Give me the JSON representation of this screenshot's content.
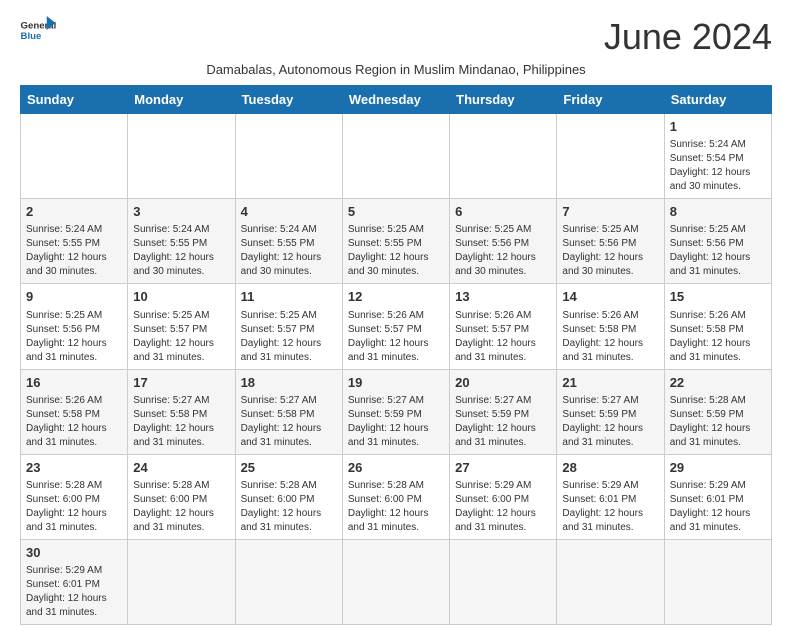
{
  "header": {
    "logo_general": "General",
    "logo_blue": "Blue",
    "month_title": "June 2024",
    "subtitle": "Damabalas, Autonomous Region in Muslim Mindanao, Philippines"
  },
  "weekdays": [
    "Sunday",
    "Monday",
    "Tuesday",
    "Wednesday",
    "Thursday",
    "Friday",
    "Saturday"
  ],
  "weeks": [
    {
      "days": [
        {
          "num": "",
          "info": ""
        },
        {
          "num": "",
          "info": ""
        },
        {
          "num": "",
          "info": ""
        },
        {
          "num": "",
          "info": ""
        },
        {
          "num": "",
          "info": ""
        },
        {
          "num": "",
          "info": ""
        },
        {
          "num": "1",
          "info": "Sunrise: 5:24 AM\nSunset: 5:54 PM\nDaylight: 12 hours and 30 minutes."
        }
      ]
    },
    {
      "days": [
        {
          "num": "2",
          "info": "Sunrise: 5:24 AM\nSunset: 5:55 PM\nDaylight: 12 hours and 30 minutes."
        },
        {
          "num": "3",
          "info": "Sunrise: 5:24 AM\nSunset: 5:55 PM\nDaylight: 12 hours and 30 minutes."
        },
        {
          "num": "4",
          "info": "Sunrise: 5:24 AM\nSunset: 5:55 PM\nDaylight: 12 hours and 30 minutes."
        },
        {
          "num": "5",
          "info": "Sunrise: 5:25 AM\nSunset: 5:55 PM\nDaylight: 12 hours and 30 minutes."
        },
        {
          "num": "6",
          "info": "Sunrise: 5:25 AM\nSunset: 5:56 PM\nDaylight: 12 hours and 30 minutes."
        },
        {
          "num": "7",
          "info": "Sunrise: 5:25 AM\nSunset: 5:56 PM\nDaylight: 12 hours and 30 minutes."
        },
        {
          "num": "8",
          "info": "Sunrise: 5:25 AM\nSunset: 5:56 PM\nDaylight: 12 hours and 31 minutes."
        }
      ]
    },
    {
      "days": [
        {
          "num": "9",
          "info": "Sunrise: 5:25 AM\nSunset: 5:56 PM\nDaylight: 12 hours and 31 minutes."
        },
        {
          "num": "10",
          "info": "Sunrise: 5:25 AM\nSunset: 5:57 PM\nDaylight: 12 hours and 31 minutes."
        },
        {
          "num": "11",
          "info": "Sunrise: 5:25 AM\nSunset: 5:57 PM\nDaylight: 12 hours and 31 minutes."
        },
        {
          "num": "12",
          "info": "Sunrise: 5:26 AM\nSunset: 5:57 PM\nDaylight: 12 hours and 31 minutes."
        },
        {
          "num": "13",
          "info": "Sunrise: 5:26 AM\nSunset: 5:57 PM\nDaylight: 12 hours and 31 minutes."
        },
        {
          "num": "14",
          "info": "Sunrise: 5:26 AM\nSunset: 5:58 PM\nDaylight: 12 hours and 31 minutes."
        },
        {
          "num": "15",
          "info": "Sunrise: 5:26 AM\nSunset: 5:58 PM\nDaylight: 12 hours and 31 minutes."
        }
      ]
    },
    {
      "days": [
        {
          "num": "16",
          "info": "Sunrise: 5:26 AM\nSunset: 5:58 PM\nDaylight: 12 hours and 31 minutes."
        },
        {
          "num": "17",
          "info": "Sunrise: 5:27 AM\nSunset: 5:58 PM\nDaylight: 12 hours and 31 minutes."
        },
        {
          "num": "18",
          "info": "Sunrise: 5:27 AM\nSunset: 5:58 PM\nDaylight: 12 hours and 31 minutes."
        },
        {
          "num": "19",
          "info": "Sunrise: 5:27 AM\nSunset: 5:59 PM\nDaylight: 12 hours and 31 minutes."
        },
        {
          "num": "20",
          "info": "Sunrise: 5:27 AM\nSunset: 5:59 PM\nDaylight: 12 hours and 31 minutes."
        },
        {
          "num": "21",
          "info": "Sunrise: 5:27 AM\nSunset: 5:59 PM\nDaylight: 12 hours and 31 minutes."
        },
        {
          "num": "22",
          "info": "Sunrise: 5:28 AM\nSunset: 5:59 PM\nDaylight: 12 hours and 31 minutes."
        }
      ]
    },
    {
      "days": [
        {
          "num": "23",
          "info": "Sunrise: 5:28 AM\nSunset: 6:00 PM\nDaylight: 12 hours and 31 minutes."
        },
        {
          "num": "24",
          "info": "Sunrise: 5:28 AM\nSunset: 6:00 PM\nDaylight: 12 hours and 31 minutes."
        },
        {
          "num": "25",
          "info": "Sunrise: 5:28 AM\nSunset: 6:00 PM\nDaylight: 12 hours and 31 minutes."
        },
        {
          "num": "26",
          "info": "Sunrise: 5:28 AM\nSunset: 6:00 PM\nDaylight: 12 hours and 31 minutes."
        },
        {
          "num": "27",
          "info": "Sunrise: 5:29 AM\nSunset: 6:00 PM\nDaylight: 12 hours and 31 minutes."
        },
        {
          "num": "28",
          "info": "Sunrise: 5:29 AM\nSunset: 6:01 PM\nDaylight: 12 hours and 31 minutes."
        },
        {
          "num": "29",
          "info": "Sunrise: 5:29 AM\nSunset: 6:01 PM\nDaylight: 12 hours and 31 minutes."
        }
      ]
    },
    {
      "days": [
        {
          "num": "30",
          "info": "Sunrise: 5:29 AM\nSunset: 6:01 PM\nDaylight: 12 hours and 31 minutes."
        },
        {
          "num": "",
          "info": ""
        },
        {
          "num": "",
          "info": ""
        },
        {
          "num": "",
          "info": ""
        },
        {
          "num": "",
          "info": ""
        },
        {
          "num": "",
          "info": ""
        },
        {
          "num": "",
          "info": ""
        }
      ]
    }
  ]
}
